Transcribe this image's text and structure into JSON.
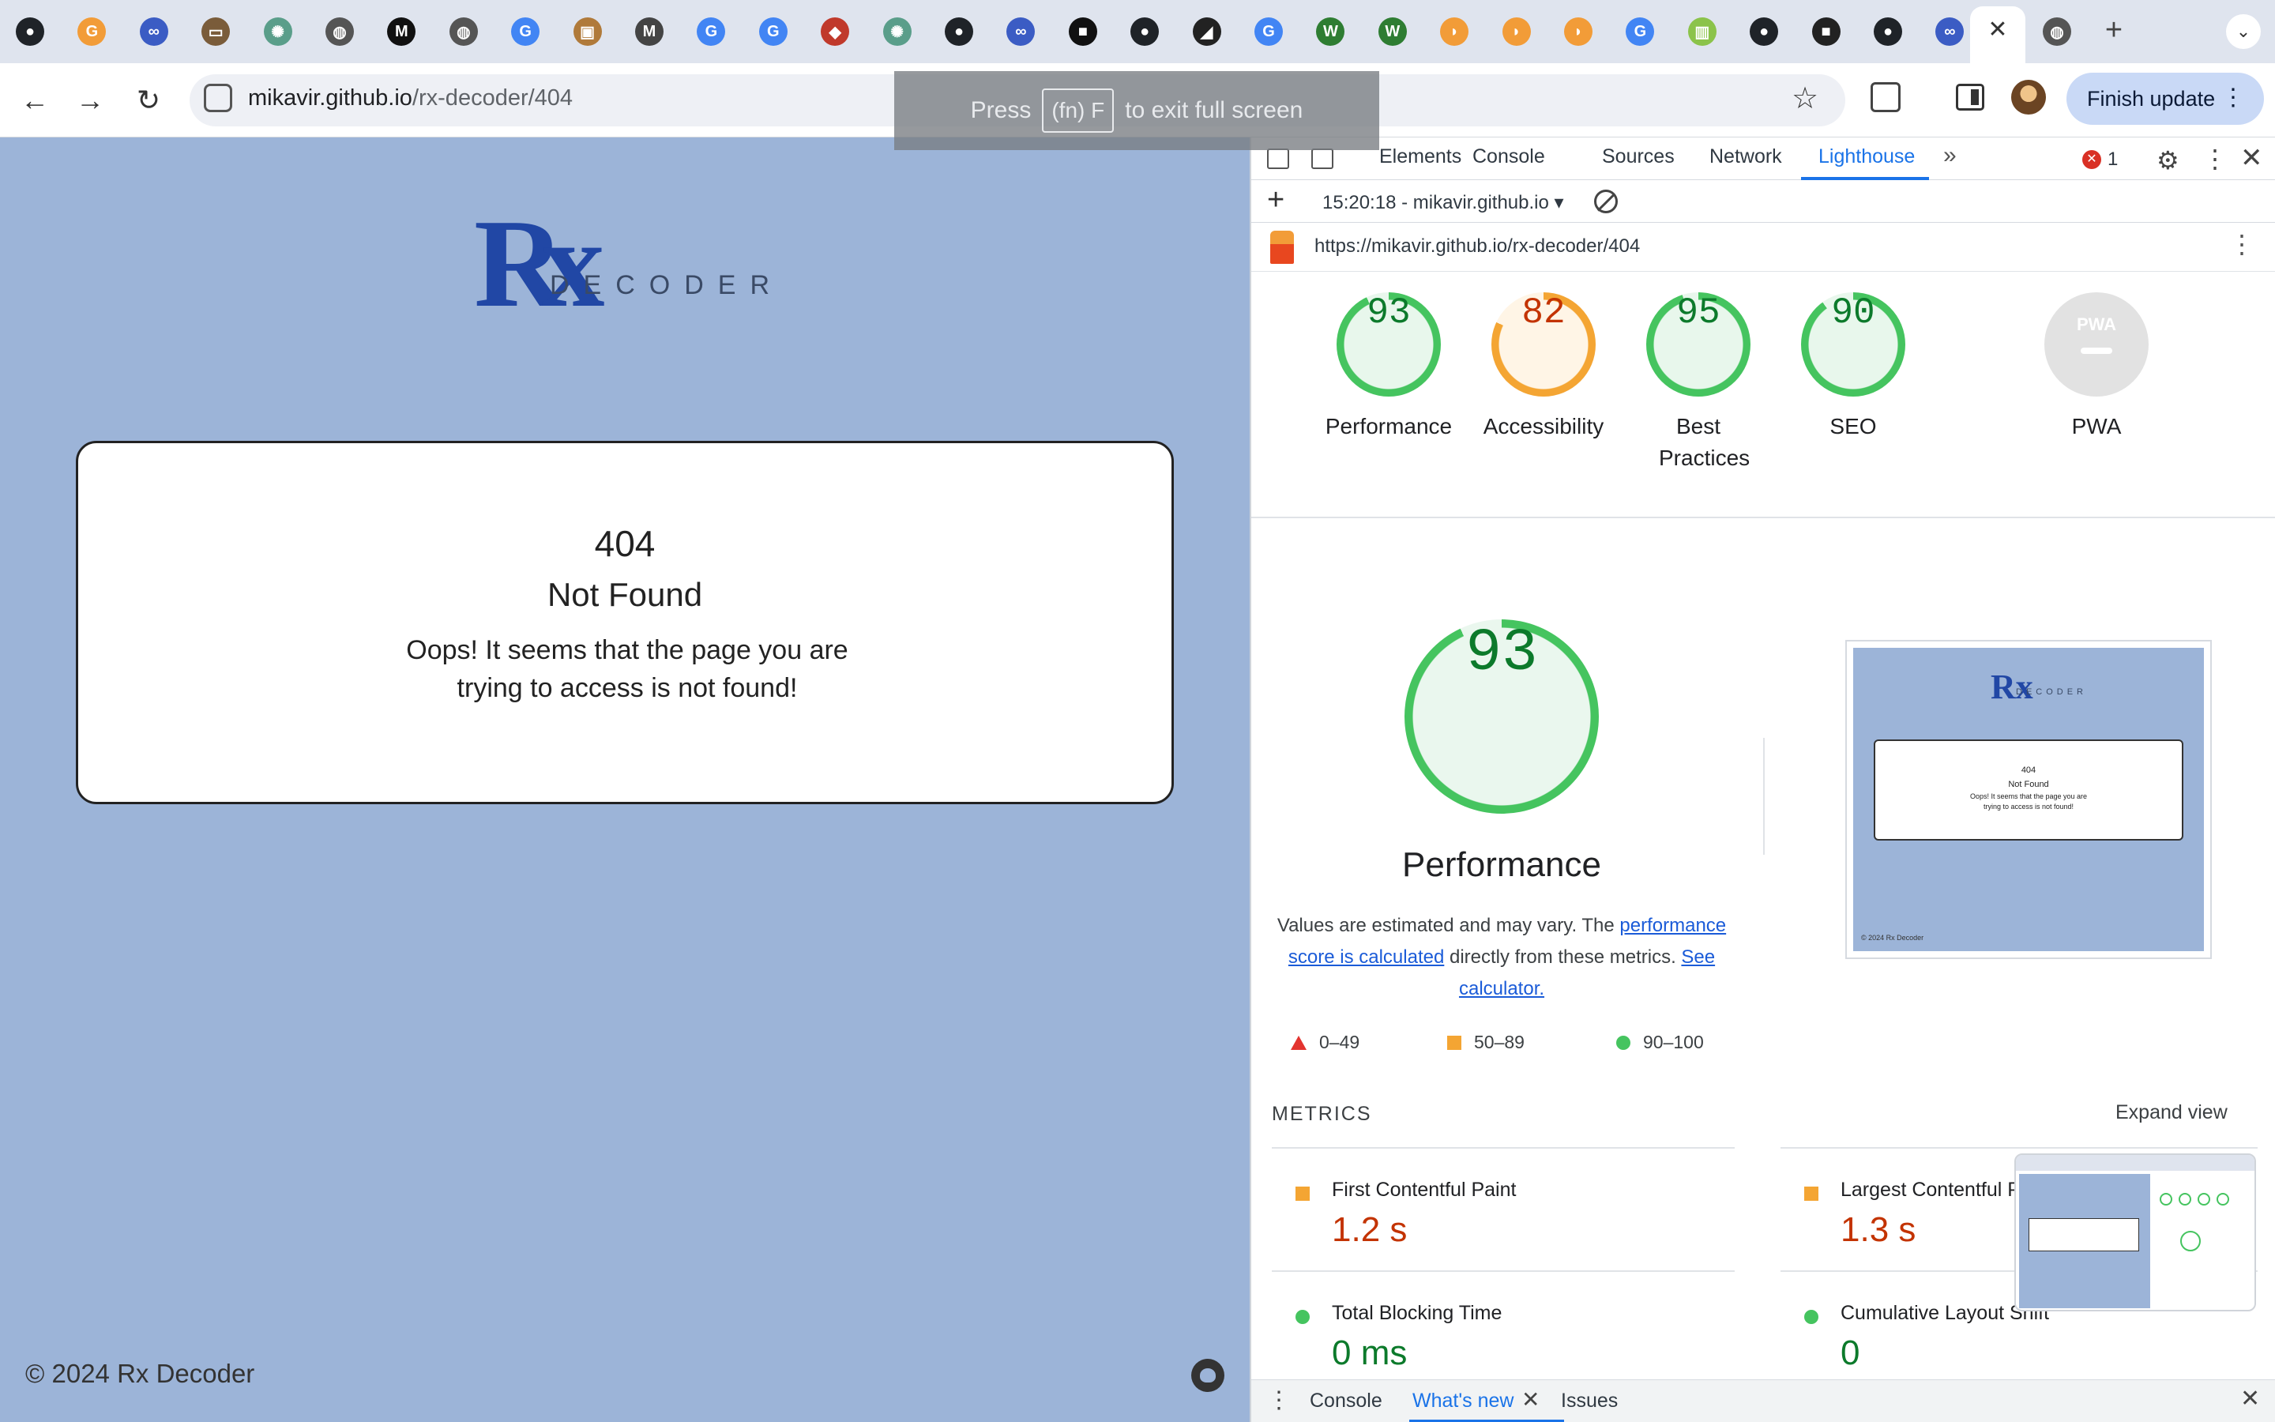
{
  "tabs": {
    "favicons": [
      {
        "icon": "github-icon",
        "color": "#1f2328",
        "glyph": "●"
      },
      {
        "icon": "grammarly-icon",
        "color": "#f29c38",
        "glyph": "G"
      },
      {
        "icon": "binoculars-icon",
        "color": "#3b5cc4",
        "glyph": "∞"
      },
      {
        "icon": "laptop-icon",
        "color": "#7a5c3a",
        "glyph": "▭"
      },
      {
        "icon": "chatgpt-icon",
        "color": "#5a9e8a",
        "glyph": "✺"
      },
      {
        "icon": "globe-icon",
        "color": "#555555",
        "glyph": "◍"
      },
      {
        "icon": "medium-icon",
        "color": "#111111",
        "glyph": "M"
      },
      {
        "icon": "globe-icon",
        "color": "#555555",
        "glyph": "◍"
      },
      {
        "icon": "google-icon",
        "color": "#4285f4",
        "glyph": "G"
      },
      {
        "icon": "package-icon",
        "color": "#b07a3a",
        "glyph": "▣"
      },
      {
        "icon": "markdown-icon",
        "color": "#444444",
        "glyph": "M"
      },
      {
        "icon": "google-icon",
        "color": "#4285f4",
        "glyph": "G"
      },
      {
        "icon": "google-icon",
        "color": "#4285f4",
        "glyph": "G"
      },
      {
        "icon": "app-icon",
        "color": "#c0392b",
        "glyph": "◆"
      },
      {
        "icon": "chatgpt-icon",
        "color": "#5a9e8a",
        "glyph": "✺"
      },
      {
        "icon": "github-icon",
        "color": "#1f2328",
        "glyph": "●"
      },
      {
        "icon": "binoculars-icon",
        "color": "#3b5cc4",
        "glyph": "∞"
      },
      {
        "icon": "dark-square-icon",
        "color": "#111111",
        "glyph": "■"
      },
      {
        "icon": "github-icon",
        "color": "#1f2328",
        "glyph": "●"
      },
      {
        "icon": "dark-logo-icon",
        "color": "#222222",
        "glyph": "◢"
      },
      {
        "icon": "google-icon",
        "color": "#4285f4",
        "glyph": "G"
      },
      {
        "icon": "w3-icon",
        "color": "#2e7d32",
        "glyph": "W"
      },
      {
        "icon": "w3-icon",
        "color": "#2e7d32",
        "glyph": "W"
      },
      {
        "icon": "shield-icon",
        "color": "#f29c38",
        "glyph": "◗"
      },
      {
        "icon": "shield-icon",
        "color": "#f29c38",
        "glyph": "◗"
      },
      {
        "icon": "shield-icon",
        "color": "#f29c38",
        "glyph": "◗"
      },
      {
        "icon": "google-icon",
        "color": "#4285f4",
        "glyph": "G"
      },
      {
        "icon": "sheets-icon",
        "color": "#8bc34a",
        "glyph": "▥"
      },
      {
        "icon": "github-icon",
        "color": "#1f2328",
        "glyph": "●"
      },
      {
        "icon": "dark-square-icon",
        "color": "#222222",
        "glyph": "■"
      },
      {
        "icon": "github-icon",
        "color": "#1f2328",
        "glyph": "●"
      },
      {
        "icon": "binoculars-icon",
        "color": "#3b5cc4",
        "glyph": "∞"
      }
    ],
    "active_close": "✕",
    "after_active": {
      "icon": "chrome-icon",
      "color": "#555555",
      "glyph": "◍"
    },
    "new_tab": "+",
    "menu": "⌄"
  },
  "toolbar": {
    "back": "←",
    "forward": "→",
    "reload": "↻",
    "url_host": "mikavir.github.io",
    "url_path": "/rx-decoder/404",
    "star": "☆",
    "finish_update": "Finish update",
    "finish_dots": "⋮"
  },
  "fullscreen_toast": {
    "press": "Press",
    "key": "(fn) F",
    "rest": "to exit full screen"
  },
  "page": {
    "logo_rx": "Rx",
    "logo_decoder": "DECODER",
    "error_code": "404",
    "error_title": "Not Found",
    "error_message": "Oops! It seems that the page you are trying to access is not found!",
    "footer": "© 2024 Rx Decoder"
  },
  "devtools": {
    "tabs": [
      "Elements",
      "Console",
      "Sources",
      "Network",
      "Lighthouse"
    ],
    "active_tab": "Lighthouse",
    "more": "»",
    "error_count": "1",
    "report_selector": "15:20:18 - mikavir.github.io ▾",
    "report_url": "https://mikavir.github.io/rx-decoder/404",
    "scores": [
      {
        "label": "Performance",
        "value": 93,
        "color": "#0c7a2b",
        "ring": "#45c45f",
        "fill": "#e8f7ec"
      },
      {
        "label": "Accessibility",
        "value": 82,
        "color": "#c33300",
        "ring": "#f4a533",
        "fill": "#fff5e6"
      },
      {
        "label": "Best Practices",
        "value": 95,
        "color": "#0c7a2b",
        "ring": "#45c45f",
        "fill": "#e8f7ec"
      },
      {
        "label": "SEO",
        "value": 90,
        "color": "#0c7a2b",
        "ring": "#45c45f",
        "fill": "#e8f7ec"
      }
    ],
    "pwa_label": "PWA",
    "pwa_badge": "PWA",
    "perf_big_value": 93,
    "perf_title": "Performance",
    "perf_desc_1": "Values are estimated and may vary. The ",
    "perf_desc_link1": "performance score is calculated",
    "perf_desc_2": " directly from these metrics. ",
    "perf_desc_link2": "See calculator.",
    "legend": [
      "0–49",
      "50–89",
      "90–100"
    ],
    "metrics_heading": "METRICS",
    "expand_view": "Expand view",
    "metrics": [
      {
        "name": "First Contentful Paint",
        "value": "1.2 s",
        "status": "average",
        "color": "#c33300"
      },
      {
        "name": "Largest Contentful Paint",
        "value": "1.3 s",
        "status": "average",
        "color": "#c33300"
      },
      {
        "name": "Total Blocking Time",
        "value": "0 ms",
        "status": "pass",
        "color": "#0c7a2b"
      },
      {
        "name": "Cumulative Layout Shift",
        "value": "0",
        "status": "pass",
        "color": "#0c7a2b"
      }
    ],
    "thumbnail": {
      "code": "404",
      "title": "Not Found",
      "msg": "Oops! It seems that the page you are trying to access is not found!",
      "footer": "© 2024 Rx Decoder"
    },
    "drawer_tabs": [
      "Console",
      "What's new",
      "Issues"
    ],
    "drawer_active": "What's new"
  }
}
